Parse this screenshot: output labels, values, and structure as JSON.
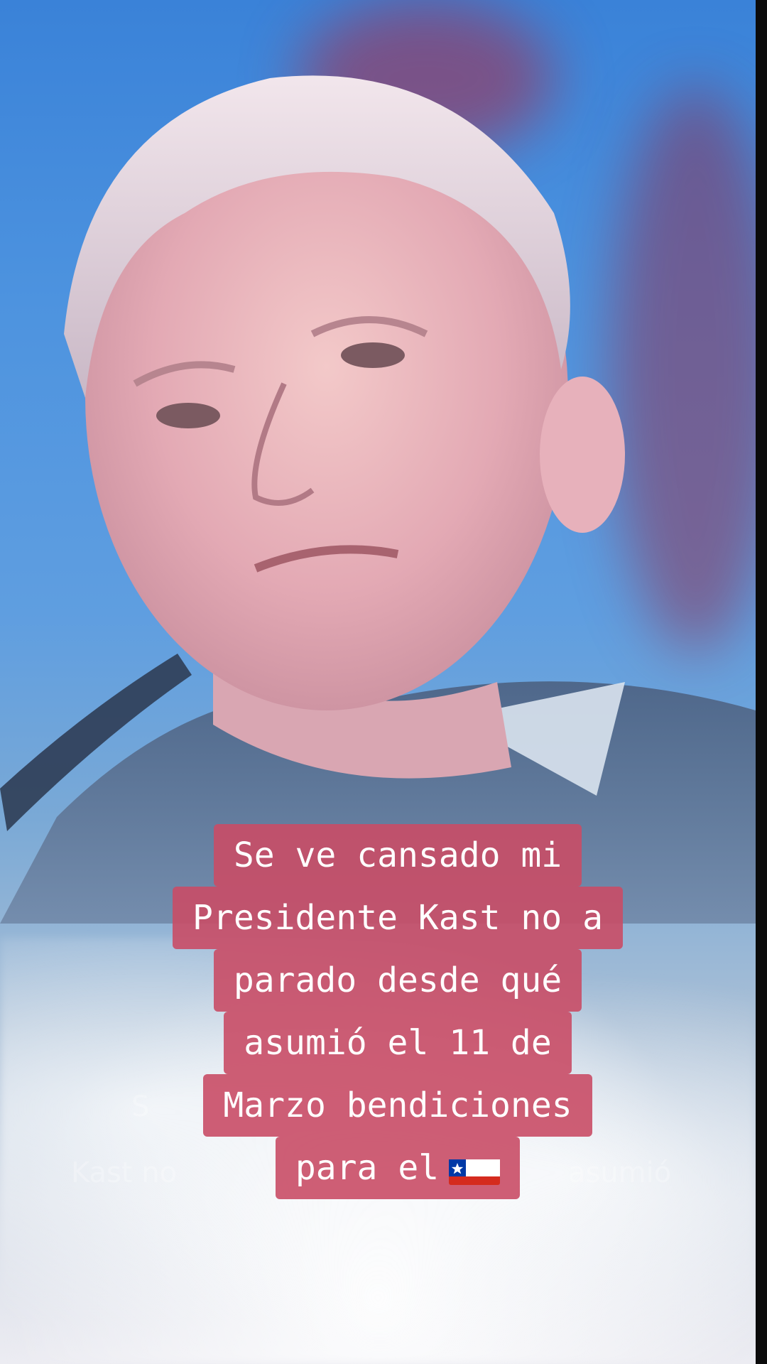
{
  "caption": {
    "lines": [
      "Se ve cansado mi",
      "Presidente Kast no a",
      "parado desde qué",
      "asumió el 11 de",
      "Marzo bendiciones",
      "para el"
    ],
    "flag": "chile-flag-icon"
  },
  "ghost_text": {
    "left": "Kast no",
    "right": "asumió",
    "mid": "S"
  },
  "colors": {
    "caption_bg": "#c94d66",
    "caption_text": "#ffffff",
    "sky": "#4d93df"
  }
}
